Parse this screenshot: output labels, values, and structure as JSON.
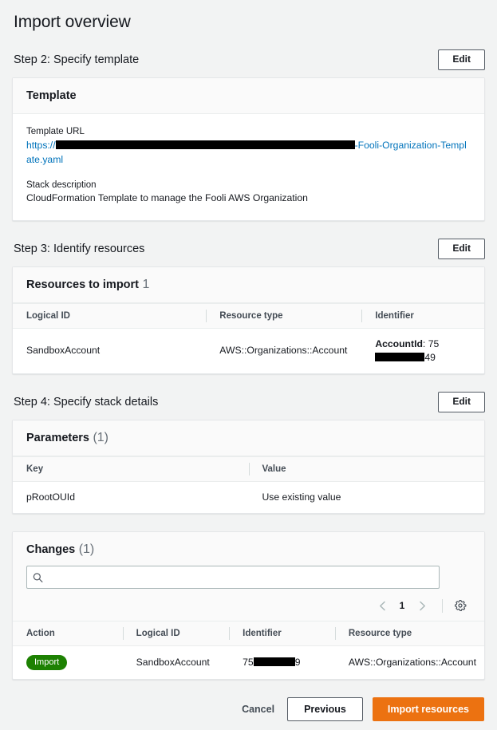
{
  "page": {
    "title": "Import overview"
  },
  "steps": [
    {
      "title": "Step 2: Specify template",
      "edit_label": "Edit",
      "card_title": "Template",
      "fields": [
        {
          "label": "Template URL",
          "url_prefix": "https://",
          "url_suffix": "-Fooli-Organization-Template.yaml",
          "redacted": true
        },
        {
          "label": "Stack description",
          "value": "CloudFormation Template to manage the Fooli AWS Organization"
        }
      ]
    },
    {
      "title": "Step 3: Identify resources",
      "edit_label": "Edit",
      "card_title": "Resources to import",
      "card_count": "1",
      "columns": [
        "Logical ID",
        "Resource type",
        "Identifier"
      ],
      "rows": [
        {
          "logical_id": "SandboxAccount",
          "resource_type": "AWS::Organizations::Account",
          "identifier_key": "AccountId",
          "identifier_prefix": "75",
          "identifier_suffix": "49"
        }
      ]
    },
    {
      "title": "Step 4: Specify stack details",
      "edit_label": "Edit",
      "card_title": "Parameters",
      "card_count": "(1)",
      "columns": [
        "Key",
        "Value"
      ],
      "rows": [
        {
          "key": "pRootOUId",
          "value": "Use existing value"
        }
      ]
    }
  ],
  "changes": {
    "title": "Changes",
    "count": "(1)",
    "search": {
      "value": "",
      "placeholder": ""
    },
    "pagination": {
      "page": "1"
    },
    "columns": [
      "Action",
      "Logical ID",
      "Identifier",
      "Resource type"
    ],
    "rows": [
      {
        "action": "Import",
        "logical_id": "SandboxAccount",
        "identifier_prefix": "75",
        "identifier_suffix": "9",
        "resource_type": "AWS::Organizations::Account"
      }
    ]
  },
  "footer": {
    "cancel_label": "Cancel",
    "previous_label": "Previous",
    "submit_label": "Import resources"
  },
  "colors": {
    "primary_button": "#ec7211",
    "badge_import": "#1d8102",
    "link": "#0073bb",
    "page_background": "#f2f3f3"
  }
}
